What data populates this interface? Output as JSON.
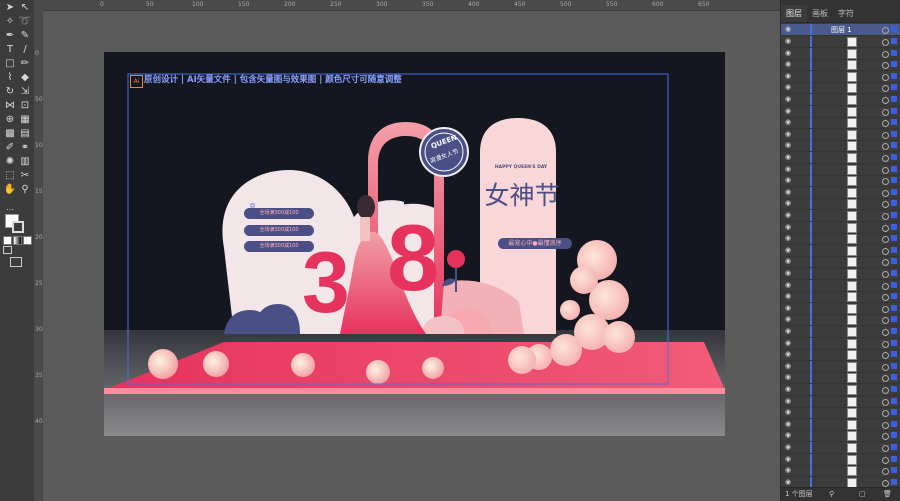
{
  "panel": {
    "tabs": [
      "图层",
      "画板",
      "字符"
    ],
    "top_layer_name": "图层 1",
    "footer_label": "1 个图层"
  },
  "artboard": {
    "ai_badge": "Ai",
    "header_text": "原创设计 | AI矢量文件 | 包含矢量图与效果图 | 颜色尺寸可随意调整",
    "badge_top": "QUEEN",
    "badge_bottom": "浪漫女人节",
    "english_title": "HAPPY QUEEN'S DAY",
    "main_title": "女神节",
    "subtitle": "最宠心中●最懂浪序",
    "num_three": "3",
    "num_eight": "8",
    "bullet_items": [
      "全场满300减100",
      "全场满300减100",
      "全场满300减100"
    ]
  },
  "rulers": {
    "top": [
      "0",
      "50",
      "100",
      "150",
      "200",
      "250",
      "300",
      "350",
      "400",
      "450",
      "500",
      "550",
      "600",
      "650"
    ],
    "left": [
      "0",
      "50",
      "100",
      "150",
      "200",
      "250",
      "300",
      "350",
      "400"
    ]
  },
  "colors": {
    "accent_pink": "#e6335d",
    "light_pink": "#f9d6d8",
    "navy": "#4a4f86",
    "selection_blue": "#4a6fe0"
  }
}
